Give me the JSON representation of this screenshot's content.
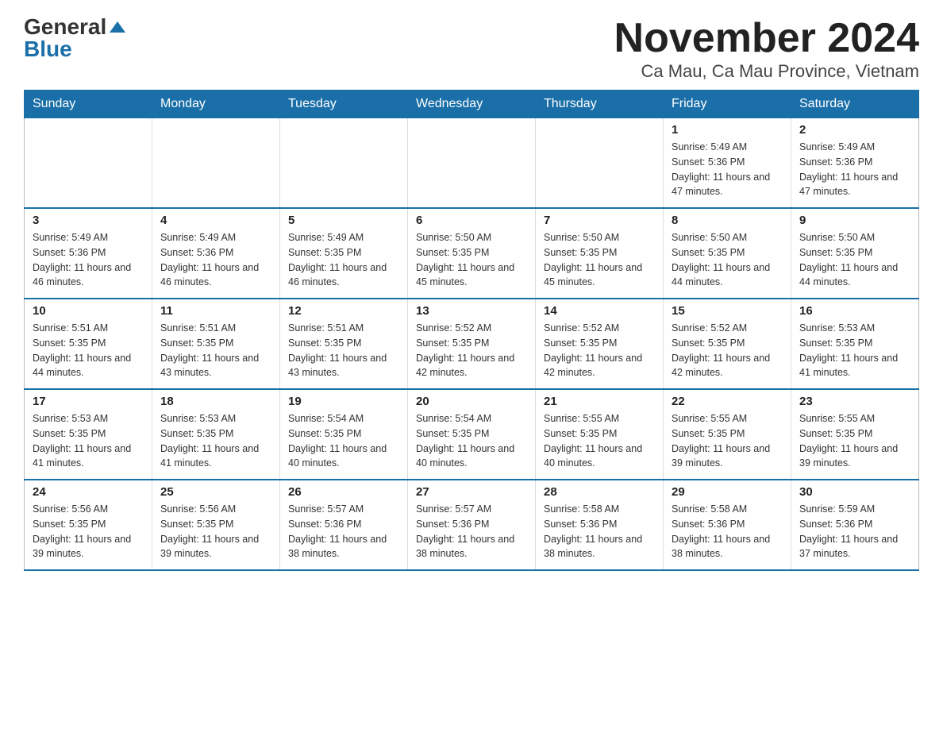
{
  "logo": {
    "general": "General",
    "blue": "Blue"
  },
  "title": "November 2024",
  "subtitle": "Ca Mau, Ca Mau Province, Vietnam",
  "days_of_week": [
    "Sunday",
    "Monday",
    "Tuesday",
    "Wednesday",
    "Thursday",
    "Friday",
    "Saturday"
  ],
  "weeks": [
    [
      {
        "day": "",
        "info": ""
      },
      {
        "day": "",
        "info": ""
      },
      {
        "day": "",
        "info": ""
      },
      {
        "day": "",
        "info": ""
      },
      {
        "day": "",
        "info": ""
      },
      {
        "day": "1",
        "info": "Sunrise: 5:49 AM\nSunset: 5:36 PM\nDaylight: 11 hours and 47 minutes."
      },
      {
        "day": "2",
        "info": "Sunrise: 5:49 AM\nSunset: 5:36 PM\nDaylight: 11 hours and 47 minutes."
      }
    ],
    [
      {
        "day": "3",
        "info": "Sunrise: 5:49 AM\nSunset: 5:36 PM\nDaylight: 11 hours and 46 minutes."
      },
      {
        "day": "4",
        "info": "Sunrise: 5:49 AM\nSunset: 5:36 PM\nDaylight: 11 hours and 46 minutes."
      },
      {
        "day": "5",
        "info": "Sunrise: 5:49 AM\nSunset: 5:35 PM\nDaylight: 11 hours and 46 minutes."
      },
      {
        "day": "6",
        "info": "Sunrise: 5:50 AM\nSunset: 5:35 PM\nDaylight: 11 hours and 45 minutes."
      },
      {
        "day": "7",
        "info": "Sunrise: 5:50 AM\nSunset: 5:35 PM\nDaylight: 11 hours and 45 minutes."
      },
      {
        "day": "8",
        "info": "Sunrise: 5:50 AM\nSunset: 5:35 PM\nDaylight: 11 hours and 44 minutes."
      },
      {
        "day": "9",
        "info": "Sunrise: 5:50 AM\nSunset: 5:35 PM\nDaylight: 11 hours and 44 minutes."
      }
    ],
    [
      {
        "day": "10",
        "info": "Sunrise: 5:51 AM\nSunset: 5:35 PM\nDaylight: 11 hours and 44 minutes."
      },
      {
        "day": "11",
        "info": "Sunrise: 5:51 AM\nSunset: 5:35 PM\nDaylight: 11 hours and 43 minutes."
      },
      {
        "day": "12",
        "info": "Sunrise: 5:51 AM\nSunset: 5:35 PM\nDaylight: 11 hours and 43 minutes."
      },
      {
        "day": "13",
        "info": "Sunrise: 5:52 AM\nSunset: 5:35 PM\nDaylight: 11 hours and 42 minutes."
      },
      {
        "day": "14",
        "info": "Sunrise: 5:52 AM\nSunset: 5:35 PM\nDaylight: 11 hours and 42 minutes."
      },
      {
        "day": "15",
        "info": "Sunrise: 5:52 AM\nSunset: 5:35 PM\nDaylight: 11 hours and 42 minutes."
      },
      {
        "day": "16",
        "info": "Sunrise: 5:53 AM\nSunset: 5:35 PM\nDaylight: 11 hours and 41 minutes."
      }
    ],
    [
      {
        "day": "17",
        "info": "Sunrise: 5:53 AM\nSunset: 5:35 PM\nDaylight: 11 hours and 41 minutes."
      },
      {
        "day": "18",
        "info": "Sunrise: 5:53 AM\nSunset: 5:35 PM\nDaylight: 11 hours and 41 minutes."
      },
      {
        "day": "19",
        "info": "Sunrise: 5:54 AM\nSunset: 5:35 PM\nDaylight: 11 hours and 40 minutes."
      },
      {
        "day": "20",
        "info": "Sunrise: 5:54 AM\nSunset: 5:35 PM\nDaylight: 11 hours and 40 minutes."
      },
      {
        "day": "21",
        "info": "Sunrise: 5:55 AM\nSunset: 5:35 PM\nDaylight: 11 hours and 40 minutes."
      },
      {
        "day": "22",
        "info": "Sunrise: 5:55 AM\nSunset: 5:35 PM\nDaylight: 11 hours and 39 minutes."
      },
      {
        "day": "23",
        "info": "Sunrise: 5:55 AM\nSunset: 5:35 PM\nDaylight: 11 hours and 39 minutes."
      }
    ],
    [
      {
        "day": "24",
        "info": "Sunrise: 5:56 AM\nSunset: 5:35 PM\nDaylight: 11 hours and 39 minutes."
      },
      {
        "day": "25",
        "info": "Sunrise: 5:56 AM\nSunset: 5:35 PM\nDaylight: 11 hours and 39 minutes."
      },
      {
        "day": "26",
        "info": "Sunrise: 5:57 AM\nSunset: 5:36 PM\nDaylight: 11 hours and 38 minutes."
      },
      {
        "day": "27",
        "info": "Sunrise: 5:57 AM\nSunset: 5:36 PM\nDaylight: 11 hours and 38 minutes."
      },
      {
        "day": "28",
        "info": "Sunrise: 5:58 AM\nSunset: 5:36 PM\nDaylight: 11 hours and 38 minutes."
      },
      {
        "day": "29",
        "info": "Sunrise: 5:58 AM\nSunset: 5:36 PM\nDaylight: 11 hours and 38 minutes."
      },
      {
        "day": "30",
        "info": "Sunrise: 5:59 AM\nSunset: 5:36 PM\nDaylight: 11 hours and 37 minutes."
      }
    ]
  ]
}
